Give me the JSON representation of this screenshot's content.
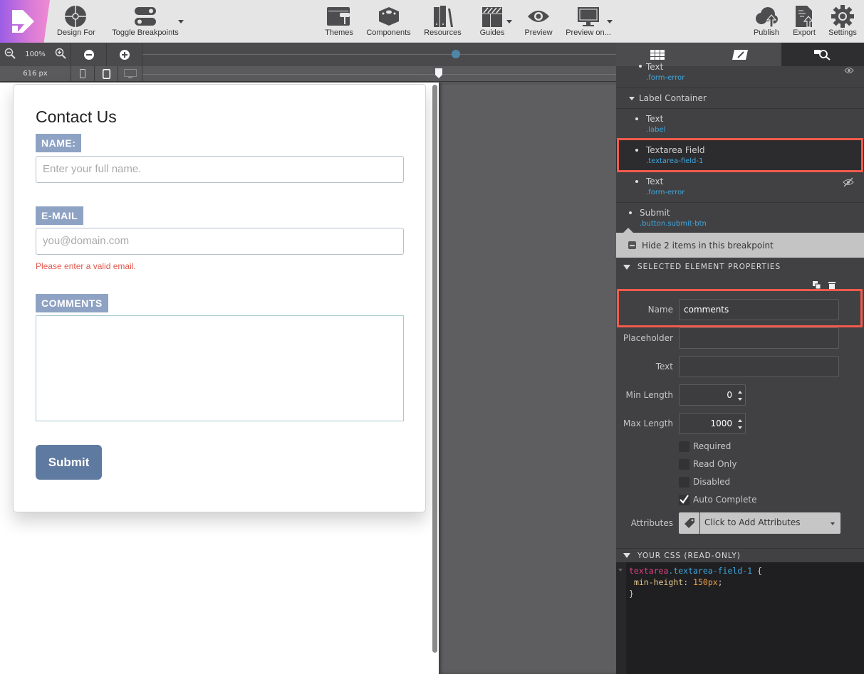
{
  "toolbar": {
    "left": [
      {
        "label": "Design For",
        "icon": "target-icon"
      },
      {
        "label": "Toggle Breakpoints",
        "icon": "toggle-icon"
      }
    ],
    "center": [
      {
        "label": "Themes",
        "icon": "paint-roller-icon"
      },
      {
        "label": "Components",
        "icon": "blocks-icon"
      },
      {
        "label": "Resources",
        "icon": "books-icon"
      },
      {
        "label": "Guides",
        "icon": "guides-icon"
      },
      {
        "label": "Preview",
        "icon": "eye-icon"
      },
      {
        "label": "Preview on...",
        "icon": "monitor-icon"
      }
    ],
    "right": [
      {
        "label": "Publish",
        "icon": "cloud-upload-icon"
      },
      {
        "label": "Export",
        "icon": "export-icon"
      },
      {
        "label": "Settings",
        "icon": "gear-icon"
      }
    ]
  },
  "zoom": {
    "level": "100%",
    "width": "616 px"
  },
  "form": {
    "title": "Contact Us",
    "name_label": "NAME:",
    "name_placeholder": "Enter your full name.",
    "email_label": "E-MAIL",
    "email_placeholder": "you@domain.com",
    "email_error": "Please enter a valid email.",
    "comments_label": "COMMENTS",
    "submit_label": "Submit"
  },
  "tree": [
    {
      "title": "Text",
      "cls": ".form-error"
    },
    {
      "title": "Label Container"
    },
    {
      "title": "Text",
      "cls": ".label"
    },
    {
      "title": "Textarea Field",
      "cls": ".textarea-field-1"
    },
    {
      "title": "Text",
      "cls": ".form-error"
    },
    {
      "title": "Submit",
      "cls": ".button.submit-btn"
    }
  ],
  "hide_items": "Hide 2 items in this breakpoint",
  "properties": {
    "heading": "SELECTED ELEMENT PROPERTIES",
    "name_label": "Name",
    "name_value": "comments",
    "placeholder_label": "Placeholder",
    "placeholder_value": "",
    "text_label": "Text",
    "text_value": "",
    "min_label": "Min Length",
    "min_value": "0",
    "max_label": "Max Length",
    "max_value": "1000",
    "checkboxes": [
      {
        "label": "Required",
        "checked": false
      },
      {
        "label": "Read Only",
        "checked": false
      },
      {
        "label": "Disabled",
        "checked": false
      },
      {
        "label": "Auto Complete",
        "checked": true
      }
    ],
    "attributes_label": "Attributes",
    "attributes_value": "Click to Add Attributes"
  },
  "css": {
    "heading": "YOUR CSS (READ-ONLY)",
    "selector_tag": "textarea",
    "selector_class": ".textarea-field-1",
    "open": " {",
    "prop": "min-height",
    "value": "150px",
    "close": "}"
  },
  "colors": {
    "accent_label": "#8ea2c4",
    "submit": "#5f7aa0",
    "error": "#e05a4f",
    "highlight": "#f25a4c",
    "class_text": "#3fa8e0"
  }
}
